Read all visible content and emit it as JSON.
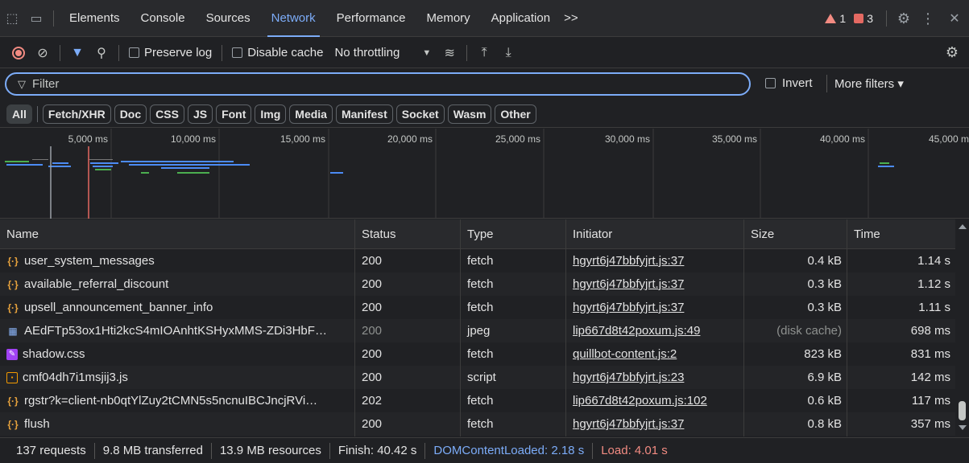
{
  "tabs": [
    {
      "label": "Elements",
      "active": false
    },
    {
      "label": "Console",
      "active": false
    },
    {
      "label": "Sources",
      "active": false
    },
    {
      "label": "Network",
      "active": true
    },
    {
      "label": "Performance",
      "active": false
    },
    {
      "label": "Memory",
      "active": false
    },
    {
      "label": "Application",
      "active": false
    }
  ],
  "tabbar": {
    "more_tabs": ">>",
    "warnings": "1",
    "errors": "3",
    "settings_icon": "gear-icon",
    "menu_icon": "⋮",
    "close_icon": "✕"
  },
  "toolbar": {
    "preserve_log": "Preserve log",
    "disable_cache": "Disable cache",
    "throttling": "No throttling"
  },
  "filter": {
    "placeholder": "Filter",
    "invert": "Invert",
    "more_filters": "More filters ▾"
  },
  "type_filters": [
    "All",
    "Fetch/XHR",
    "Doc",
    "CSS",
    "JS",
    "Font",
    "Img",
    "Media",
    "Manifest",
    "Socket",
    "Wasm",
    "Other"
  ],
  "overview": {
    "ticks": [
      "5,000 ms",
      "10,000 ms",
      "15,000 ms",
      "20,000 ms",
      "25,000 ms",
      "30,000 ms",
      "35,000 ms",
      "40,000 ms",
      "45,000 m"
    ]
  },
  "columns": {
    "name": "Name",
    "status": "Status",
    "type": "Type",
    "initiator": "Initiator",
    "size": "Size",
    "time": "Time"
  },
  "rows": [
    {
      "icon": "fetch",
      "name": "user_system_messages",
      "status": "200",
      "type": "fetch",
      "initiator": "hgyrt6j47bbfyjrt.js:37",
      "size": "0.4 kB",
      "time": "1.14 s"
    },
    {
      "icon": "fetch",
      "name": "available_referral_discount",
      "status": "200",
      "type": "fetch",
      "initiator": "hgyrt6j47bbfyjrt.js:37",
      "size": "0.3 kB",
      "time": "1.12 s"
    },
    {
      "icon": "fetch",
      "name": "upsell_announcement_banner_info",
      "status": "200",
      "type": "fetch",
      "initiator": "hgyrt6j47bbfyjrt.js:37",
      "size": "0.3 kB",
      "time": "1.11 s"
    },
    {
      "icon": "image",
      "name": "AEdFTp53ox1Hti2kcS4mIOAnhtKSHyxMMS-ZDi3HbF…",
      "status": "200",
      "type": "jpeg",
      "initiator": "lip667d8t42poxum.js:49",
      "size": "(disk cache)",
      "time": "698 ms",
      "cached": true
    },
    {
      "icon": "css",
      "name": "shadow.css",
      "status": "200",
      "type": "fetch",
      "initiator": "quillbot-content.js:2",
      "size": "823 kB",
      "time": "831 ms"
    },
    {
      "icon": "script",
      "name": "cmf04dh7i1msjij3.js",
      "status": "200",
      "type": "script",
      "initiator": "hgyrt6j47bbfyjrt.js:23",
      "size": "6.9 kB",
      "time": "142 ms"
    },
    {
      "icon": "fetch",
      "name": "rgstr?k=client-nb0qtYlZuy2tCMN5s5ncnuIBCJncjRVi…",
      "status": "202",
      "type": "fetch",
      "initiator": "lip667d8t42poxum.js:102",
      "size": "0.6 kB",
      "time": "117 ms"
    },
    {
      "icon": "fetch",
      "name": "flush",
      "status": "200",
      "type": "fetch",
      "initiator": "hgyrt6j47bbfyjrt.js:37",
      "size": "0.8 kB",
      "time": "357 ms"
    }
  ],
  "statusbar": {
    "requests": "137 requests",
    "transferred": "9.8 MB transferred",
    "resources": "13.9 MB resources",
    "finish": "Finish: 40.42 s",
    "dcl": "DOMContentLoaded: 2.18 s",
    "load": "Load: 4.01 s"
  },
  "colors": {
    "accent": "#7cacf8",
    "error": "#f28b82",
    "background": "#202124"
  }
}
